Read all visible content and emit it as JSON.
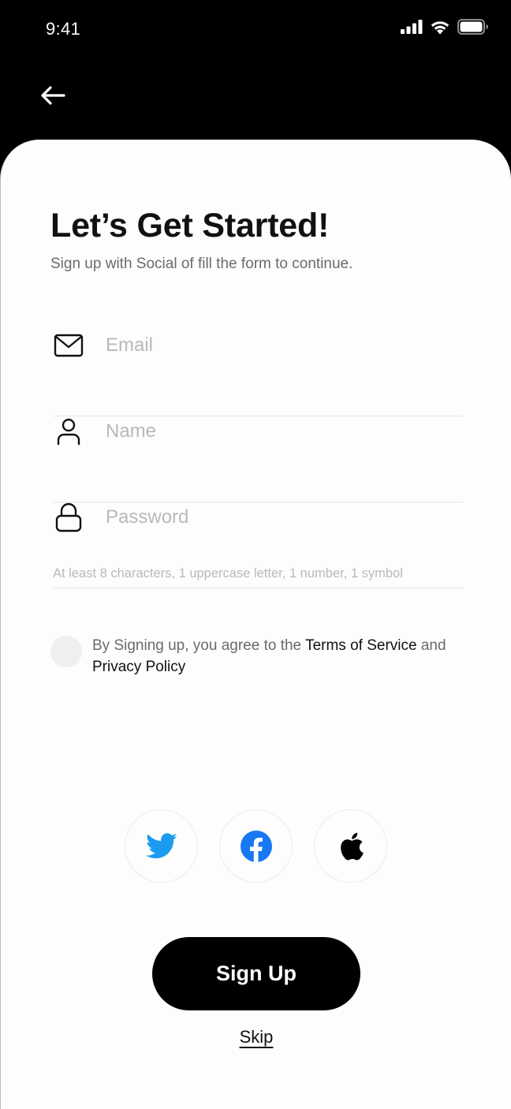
{
  "status_bar": {
    "time": "9:41"
  },
  "header": {
    "back_icon": "arrow-left-icon"
  },
  "main": {
    "title": "Let’s Get Started!",
    "subtitle": "Sign up with Social of fill the form to continue."
  },
  "form": {
    "email": {
      "icon": "mail-icon",
      "placeholder": "Email",
      "value": ""
    },
    "name": {
      "icon": "user-icon",
      "placeholder": "Name",
      "value": ""
    },
    "password": {
      "icon": "lock-icon",
      "placeholder": "Password",
      "value": ""
    },
    "password_hint": "At least 8 characters, 1 uppercase letter, 1 number, 1 symbol"
  },
  "agreement": {
    "checked": false,
    "text_before": "By Signing up, you agree to the ",
    "terms_label": "Terms of Service",
    "text_middle": " and ",
    "privacy_label": "Privacy Policy"
  },
  "social": {
    "buttons": [
      {
        "icon": "twitter-icon",
        "color": "#1d9bf0"
      },
      {
        "icon": "facebook-icon",
        "color": "#1877f2"
      },
      {
        "icon": "apple-icon",
        "color": "#000000"
      }
    ]
  },
  "actions": {
    "signup_label": "Sign Up",
    "skip_label": "Skip"
  }
}
